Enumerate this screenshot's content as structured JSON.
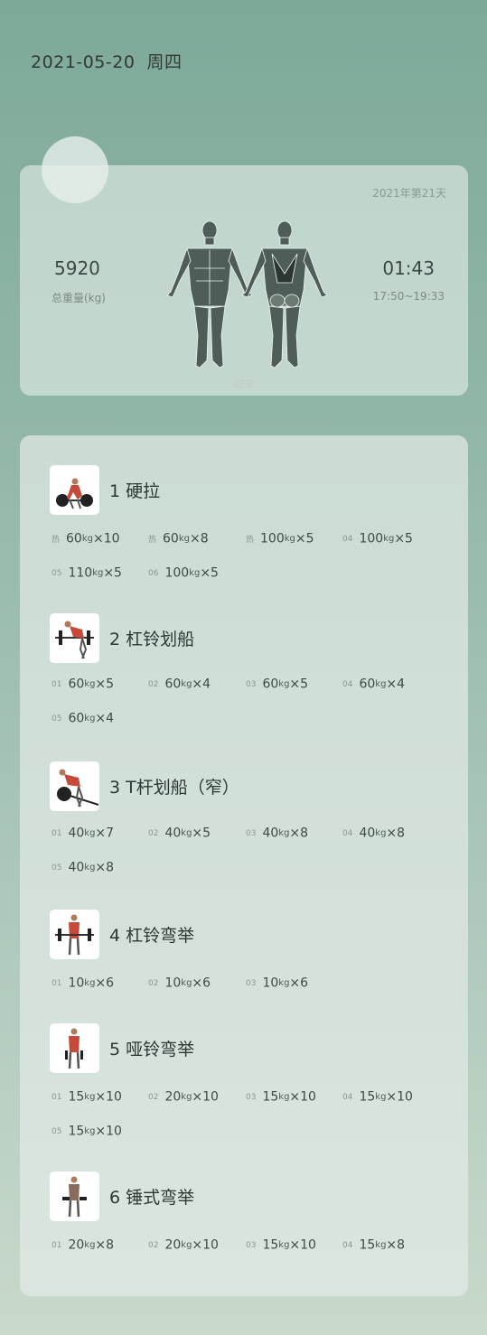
{
  "header": {
    "date": "2021-05-20",
    "weekday": "周四"
  },
  "summary": {
    "year_day": "2021年第21天",
    "total_weight": "5920",
    "total_weight_label": "总重量(kg)",
    "duration": "01:43",
    "time_range": "17:50~19:33",
    "record_label": "記录"
  },
  "exercises": [
    {
      "title": "1  硬拉",
      "thumb_icon": "deadlift-icon",
      "sets": [
        {
          "idx": "热",
          "w": "60",
          "u": "kg",
          "r": "×10"
        },
        {
          "idx": "热",
          "w": "60",
          "u": "kg",
          "r": "×8"
        },
        {
          "idx": "热",
          "w": "100",
          "u": "kg",
          "r": "×5"
        },
        {
          "idx": "04",
          "w": "100",
          "u": "kg",
          "r": "×5"
        },
        {
          "idx": "05",
          "w": "110",
          "u": "kg",
          "r": "×5"
        },
        {
          "idx": "06",
          "w": "100",
          "u": "kg",
          "r": "×5"
        }
      ]
    },
    {
      "title": "2  杠铃划船",
      "thumb_icon": "barbell-row-icon",
      "sets": [
        {
          "idx": "01",
          "w": "60",
          "u": "kg",
          "r": "×5"
        },
        {
          "idx": "02",
          "w": "60",
          "u": "kg",
          "r": "×4"
        },
        {
          "idx": "03",
          "w": "60",
          "u": "kg",
          "r": "×5"
        },
        {
          "idx": "04",
          "w": "60",
          "u": "kg",
          "r": "×4"
        },
        {
          "idx": "05",
          "w": "60",
          "u": "kg",
          "r": "×4"
        }
      ]
    },
    {
      "title": "3  T杆划船（窄）",
      "thumb_icon": "t-bar-row-icon",
      "sets": [
        {
          "idx": "01",
          "w": "40",
          "u": "kg",
          "r": "×7"
        },
        {
          "idx": "02",
          "w": "40",
          "u": "kg",
          "r": "×5"
        },
        {
          "idx": "03",
          "w": "40",
          "u": "kg",
          "r": "×8"
        },
        {
          "idx": "04",
          "w": "40",
          "u": "kg",
          "r": "×8"
        },
        {
          "idx": "05",
          "w": "40",
          "u": "kg",
          "r": "×8"
        }
      ]
    },
    {
      "title": "4  杠铃弯举",
      "thumb_icon": "barbell-curl-icon",
      "sets": [
        {
          "idx": "01",
          "w": "10",
          "u": "kg",
          "r": "×6"
        },
        {
          "idx": "02",
          "w": "10",
          "u": "kg",
          "r": "×6"
        },
        {
          "idx": "03",
          "w": "10",
          "u": "kg",
          "r": "×6"
        }
      ]
    },
    {
      "title": "5  哑铃弯举",
      "thumb_icon": "dumbbell-curl-icon",
      "sets": [
        {
          "idx": "01",
          "w": "15",
          "u": "kg",
          "r": "×10"
        },
        {
          "idx": "02",
          "w": "20",
          "u": "kg",
          "r": "×10"
        },
        {
          "idx": "03",
          "w": "15",
          "u": "kg",
          "r": "×10"
        },
        {
          "idx": "04",
          "w": "15",
          "u": "kg",
          "r": "×10"
        },
        {
          "idx": "05",
          "w": "15",
          "u": "kg",
          "r": "×10"
        }
      ]
    },
    {
      "title": "6  锤式弯举",
      "thumb_icon": "hammer-curl-icon",
      "sets": [
        {
          "idx": "01",
          "w": "20",
          "u": "kg",
          "r": "×8"
        },
        {
          "idx": "02",
          "w": "20",
          "u": "kg",
          "r": "×10"
        },
        {
          "idx": "03",
          "w": "15",
          "u": "kg",
          "r": "×10"
        },
        {
          "idx": "04",
          "w": "15",
          "u": "kg",
          "r": "×8"
        }
      ]
    }
  ]
}
